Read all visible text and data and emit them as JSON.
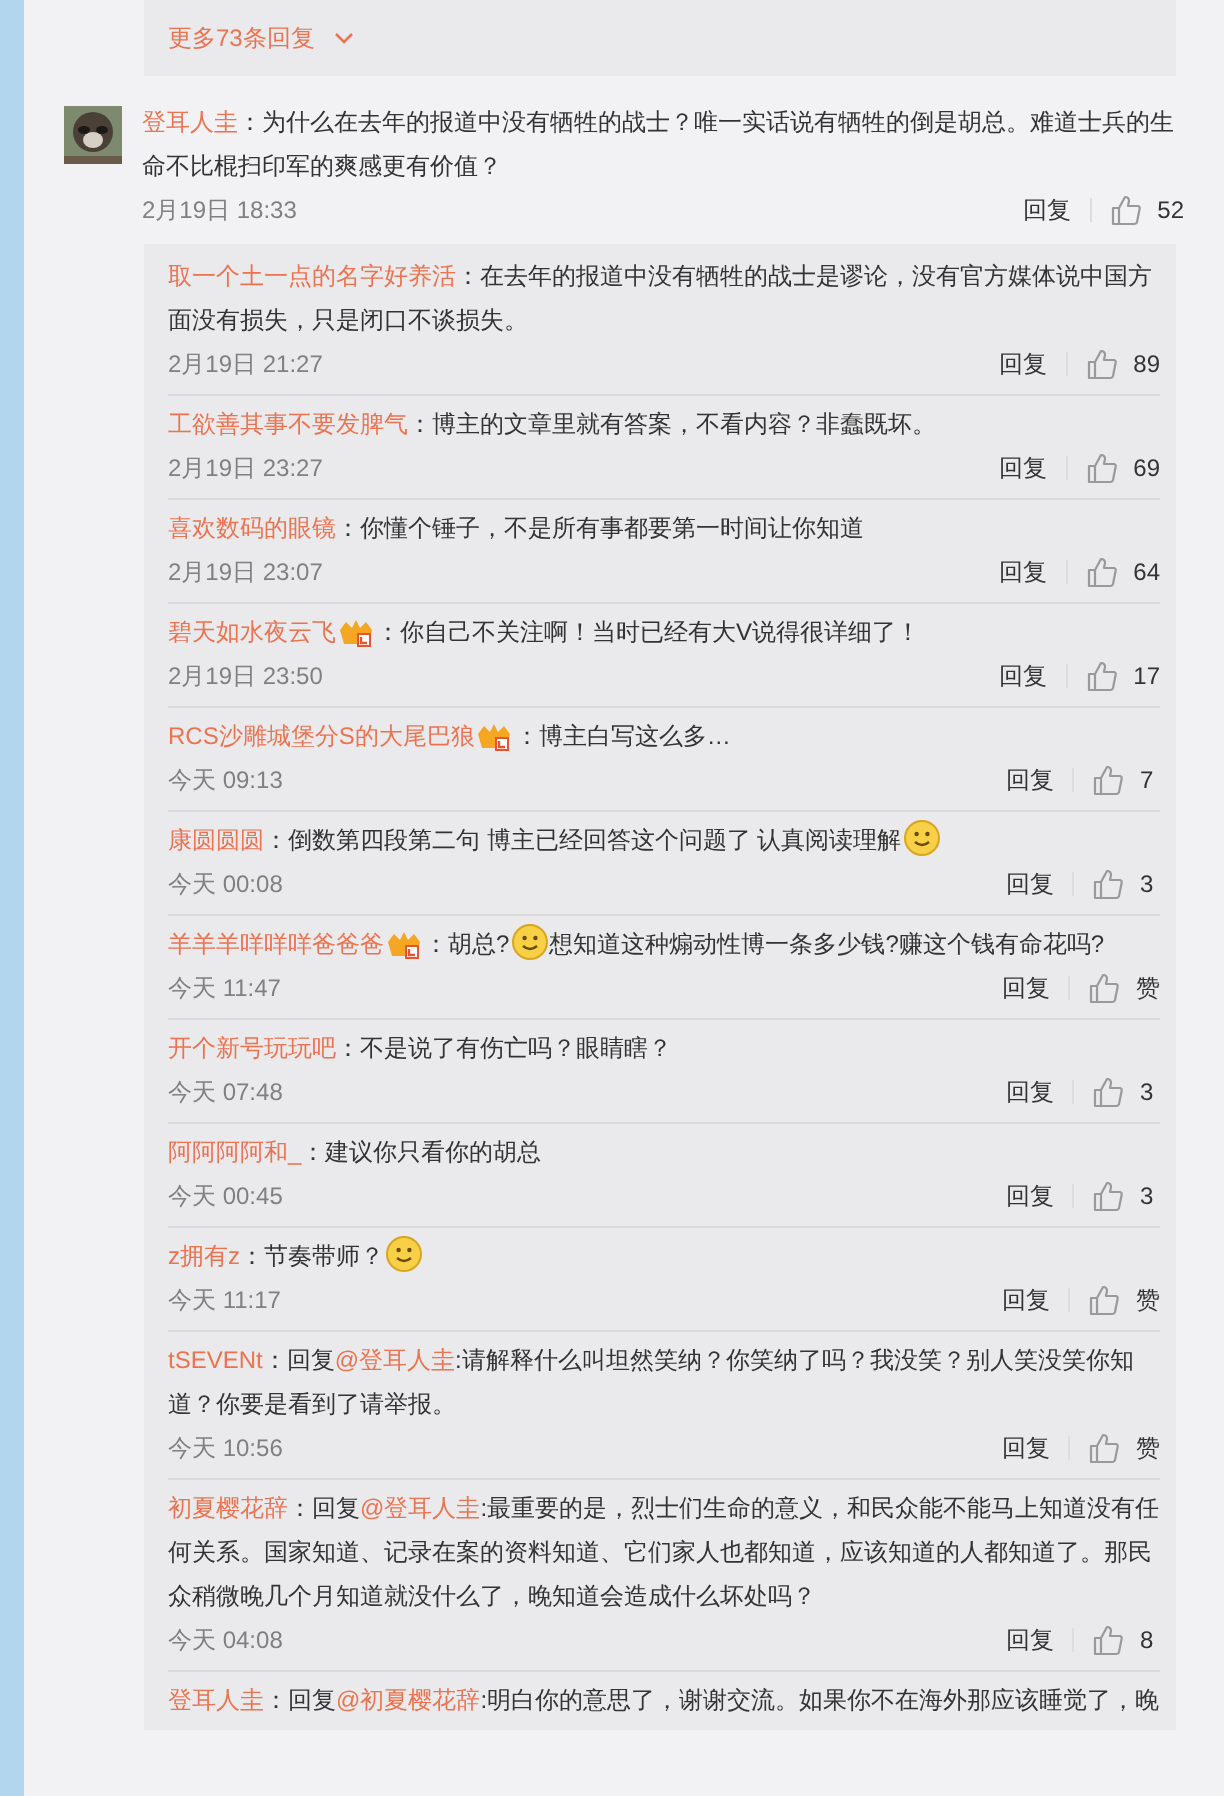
{
  "more_replies": {
    "label": "更多73条回复"
  },
  "comment": {
    "user": "登耳人圭",
    "parts": [
      {
        "kind": "text",
        "text": "：为什么在去年的报道中没有牺牲的战士？唯一实话说有牺牲的倒是胡总。难道士兵的生命不比棍扫印军的爽感更有价值？"
      }
    ],
    "time": "2月19日 18:33",
    "reply_label": "回复",
    "likes": "52",
    "replies": [
      {
        "user": "取一个土一点的名字好养活",
        "badge": false,
        "parts": [
          {
            "kind": "text",
            "text": "：在去年的报道中没有牺牲的战士是谬论，没有官方媒体说中国方面没有损失，只是闭口不谈损失。"
          }
        ],
        "time": "2月19日 21:27",
        "reply_label": "回复",
        "likes": "89"
      },
      {
        "user": "工欲善其事不要发脾气",
        "badge": false,
        "parts": [
          {
            "kind": "text",
            "text": "：博主的文章里就有答案，不看内容？非蠢既坏。"
          }
        ],
        "time": "2月19日 23:27",
        "reply_label": "回复",
        "likes": "69"
      },
      {
        "user": "喜欢数码的眼镜",
        "badge": false,
        "parts": [
          {
            "kind": "text",
            "text": "：你懂个锤子，不是所有事都要第一时间让你知道"
          }
        ],
        "time": "2月19日 23:07",
        "reply_label": "回复",
        "likes": "64"
      },
      {
        "user": "碧天如水夜云飞",
        "badge": true,
        "parts": [
          {
            "kind": "text",
            "text": "：你自己不关注啊！当时已经有大V说得很详细了！"
          }
        ],
        "time": "2月19日 23:50",
        "reply_label": "回复",
        "likes": "17"
      },
      {
        "user": "RCS沙雕城堡分S的大尾巴狼",
        "badge": true,
        "parts": [
          {
            "kind": "text",
            "text": "：博主白写这么多…"
          }
        ],
        "time": "今天 09:13",
        "reply_label": "回复",
        "likes": "7"
      },
      {
        "user": "康圆圆圆",
        "badge": false,
        "parts": [
          {
            "kind": "text",
            "text": "：倒数第四段第二句 博主已经回答这个问题了 认真阅读理解"
          },
          {
            "kind": "emoji"
          }
        ],
        "time": "今天 00:08",
        "reply_label": "回复",
        "likes": "3"
      },
      {
        "user": "羊羊羊咩咩咩爸爸爸",
        "badge": true,
        "parts": [
          {
            "kind": "text",
            "text": "：胡总?"
          },
          {
            "kind": "emoji"
          },
          {
            "kind": "text",
            "text": "想知道这种煽动性博一条多少钱?赚这个钱有命花吗?"
          }
        ],
        "time": "今天 11:47",
        "reply_label": "回复",
        "likes": "赞"
      },
      {
        "user": "开个新号玩玩吧",
        "badge": false,
        "parts": [
          {
            "kind": "text",
            "text": "：不是说了有伤亡吗？眼睛瞎？"
          }
        ],
        "time": "今天 07:48",
        "reply_label": "回复",
        "likes": "3"
      },
      {
        "user": "阿阿阿阿和_",
        "badge": false,
        "parts": [
          {
            "kind": "text",
            "text": "：建议你只看你的胡总"
          }
        ],
        "time": "今天 00:45",
        "reply_label": "回复",
        "likes": "3"
      },
      {
        "user": "z拥有z",
        "badge": false,
        "parts": [
          {
            "kind": "text",
            "text": "：节奏带师？"
          },
          {
            "kind": "emoji"
          }
        ],
        "time": "今天 11:17",
        "reply_label": "回复",
        "likes": "赞"
      },
      {
        "user": "tSEVENt",
        "badge": false,
        "parts": [
          {
            "kind": "text",
            "text": "：回复"
          },
          {
            "kind": "mention",
            "text": "@登耳人圭"
          },
          {
            "kind": "text",
            "text": ":请解释什么叫坦然笑纳？你笑纳了吗？我没笑？别人笑没笑你知道？你要是看到了请举报。"
          }
        ],
        "time": "今天 10:56",
        "reply_label": "回复",
        "likes": "赞"
      },
      {
        "user": "初夏樱花辞",
        "badge": false,
        "parts": [
          {
            "kind": "text",
            "text": "：回复"
          },
          {
            "kind": "mention",
            "text": "@登耳人圭"
          },
          {
            "kind": "text",
            "text": ":最重要的是，烈士们生命的意义，和民众能不能马上知道没有任何关系。国家知道、记录在案的资料知道、它们家人也都知道，应该知道的人都知道了。那民众稍微晚几个月知道就没什么了，晚知道会造成什么坏处吗？"
          }
        ],
        "time": "今天 04:08",
        "reply_label": "回复",
        "likes": "8"
      },
      {
        "user": "登耳人圭",
        "badge": false,
        "parts": [
          {
            "kind": "text",
            "text": "：回复"
          },
          {
            "kind": "mention",
            "text": "@初夏樱花辞"
          },
          {
            "kind": "text",
            "text": ":明白你的意思了，谢谢交流。如果你不在海外那应该睡觉了，晚"
          }
        ]
      }
    ]
  }
}
